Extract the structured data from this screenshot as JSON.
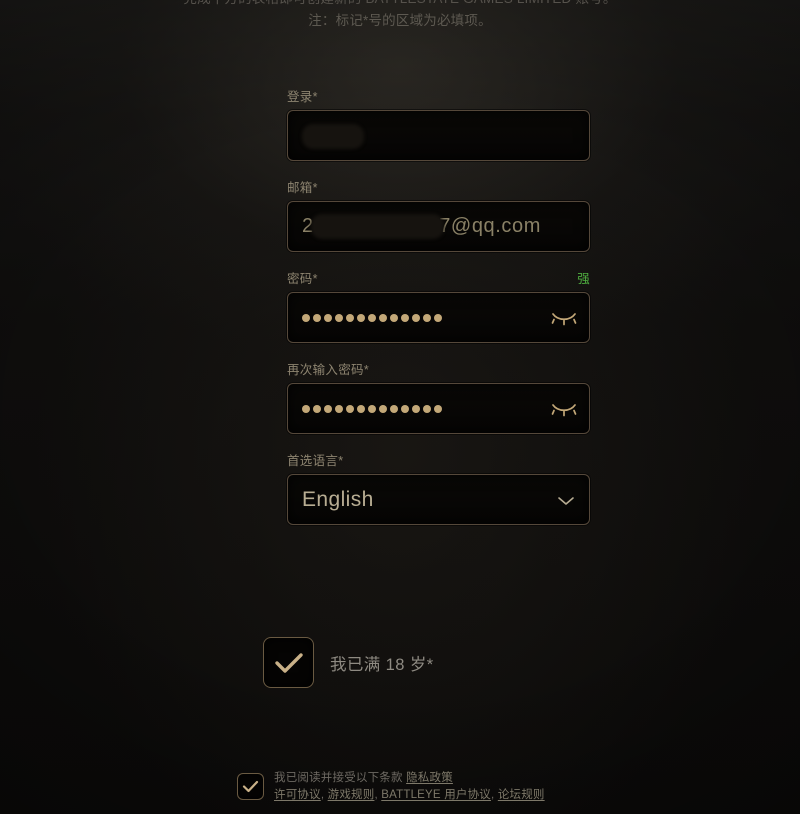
{
  "intro": {
    "line1": "完成下方的表格即可创建新的 BATTLESTATE GAMES LIMITED 账号。",
    "line2": "注：标记*号的区域为必填项。"
  },
  "form": {
    "fields": [
      {
        "key": "login",
        "label": "登录",
        "required_mark": "*",
        "type": "text",
        "value": "",
        "redacted": true
      },
      {
        "key": "email",
        "label": "邮箱",
        "required_mark": "*",
        "type": "text",
        "value_prefix": "2",
        "value_suffix": "7@qq.com",
        "redacted": true
      },
      {
        "key": "password",
        "label": "密码",
        "required_mark": "*",
        "type": "password",
        "dot_count": 13,
        "strength_label": "强",
        "strength_color": "#4fae3f",
        "reveal_icon": "eye-closed-icon"
      },
      {
        "key": "password_confirm",
        "label": "再次输入密码",
        "required_mark": "*",
        "type": "password",
        "dot_count": 13,
        "reveal_icon": "eye-closed-icon"
      },
      {
        "key": "language",
        "label": "首选语言",
        "required_mark": "*",
        "type": "select",
        "value": "English",
        "chevron_icon": "chevron-down-icon"
      }
    ]
  },
  "age_consent": {
    "label": "我已满 18 岁",
    "required_mark": "*",
    "checked": true,
    "check_icon": "check-icon"
  },
  "terms_consent": {
    "checked": true,
    "check_icon": "check-icon",
    "intro": "我已阅读并接受以下条款",
    "links_line1": [
      {
        "label": "隐私政策"
      }
    ],
    "links_line2": [
      {
        "label": "许可协议"
      },
      {
        "label": "游戏规则"
      },
      {
        "label": "BATTLEYE 用户协议"
      },
      {
        "label": "论坛规则"
      }
    ],
    "separator": ","
  },
  "colors": {
    "background": "#0d0c0b",
    "field_border": "#55483a",
    "label_text": "#8d8470",
    "input_text": "#8a8166",
    "accent_green": "#4fae3f",
    "dot_color": "#c3a878",
    "check_color": "#c9b188"
  }
}
